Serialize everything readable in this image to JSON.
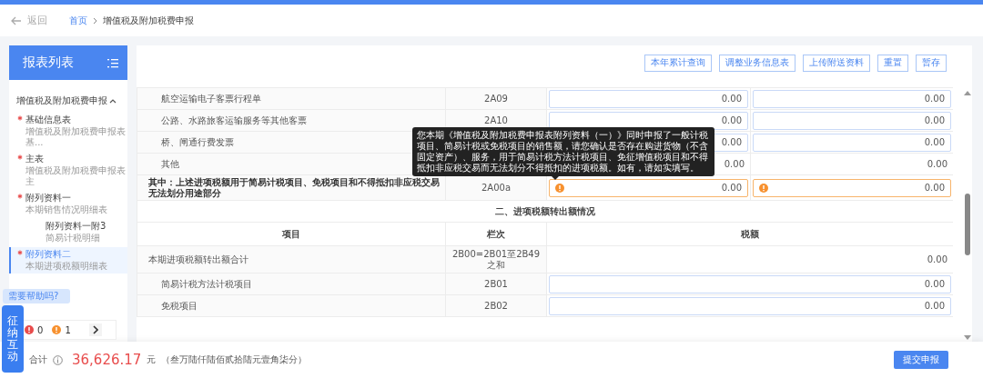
{
  "nav": {
    "back": "返回",
    "breadcrumb": [
      {
        "label": "首页",
        "kind": "link"
      },
      {
        "label": "增值税及附加税费申报",
        "kind": "current"
      }
    ]
  },
  "sidebar": {
    "title": "报表列表",
    "groups": [
      {
        "label": "增值税及附加税费申报",
        "expanded": true,
        "children": [
          {
            "label": "基础信息表",
            "subtitle": "增值税及附加税费申报表基...",
            "required": true,
            "selected": false
          },
          {
            "label": "主表",
            "subtitle": "增值税及附加税费申报表主",
            "required": true,
            "selected": false
          },
          {
            "label": "附列资料一",
            "subtitle": "本期销售情况明细表",
            "required": true,
            "selected": false,
            "children": [
              {
                "label": "附列资料一附3",
                "subtitle": "简易计税明细",
                "required": false,
                "selected": false
              }
            ]
          },
          {
            "label": "附列资料二",
            "subtitle": "本期进项税额明细表",
            "required": true,
            "selected": true
          }
        ]
      }
    ]
  },
  "toolbar": [
    "本年累计查询",
    "调整业务信息表",
    "上传附送资料",
    "重置",
    "暂存"
  ],
  "table": {
    "rows": [
      {
        "label": "航空运输电子客票行程单",
        "code": "2A09",
        "indented": true,
        "bold": false,
        "cells": [
          {
            "kind": "input",
            "value": "0.00"
          },
          {
            "kind": "input",
            "value": "0.00"
          }
        ]
      },
      {
        "label": "公路、水路旅客运输服务等其他客票",
        "code": "2A10",
        "indented": true,
        "bold": false,
        "cells": [
          {
            "kind": "input",
            "value": "0.00"
          },
          {
            "kind": "input",
            "value": "0.00"
          }
        ]
      },
      {
        "label": "桥、闸通行费发票",
        "indented": true,
        "bold": false,
        "cells": [
          {
            "kind": "input",
            "value": "0.00"
          },
          {
            "kind": "input",
            "value": "0.00"
          }
        ]
      },
      {
        "label": "其他",
        "indented": true,
        "bold": false,
        "cells": [
          {
            "kind": "text",
            "value": "0.00"
          },
          {
            "kind": "text",
            "value": "0.00"
          }
        ]
      },
      {
        "label": "其中：上述进项税额用于简易计税项目、免税项目和不得抵扣非应税交易无法划分用途部分",
        "code": "2A00a",
        "indented": false,
        "bold": true,
        "cells": [
          {
            "kind": "warning",
            "value": "0.00"
          },
          {
            "kind": "warning",
            "value": "0.00"
          }
        ]
      }
    ]
  },
  "transfer_section": {
    "title": "二、进项税额转出额情况",
    "columns": [
      "项目",
      "栏次",
      "税额"
    ],
    "rows": [
      {
        "label": "本期进项税额转出额合计",
        "code": "2B00=2B01至2B49之和",
        "indented": false,
        "cell": {
          "kind": "text",
          "value": "0.00"
        }
      },
      {
        "label": "简易计税方法计税项目",
        "code": "2B01",
        "indented": true,
        "cell": {
          "kind": "input",
          "value": "0.00"
        }
      },
      {
        "label": "免税项目",
        "code": "2B02",
        "indented": true,
        "cell": {
          "kind": "input",
          "value": "0.00"
        }
      }
    ]
  },
  "tooltip": "您本期《增值税及附加税费申报表附列资料（一）》同时申报了一般计税项目、简易计税或免税项目的销售额，请您确认是否存在购进货物（不含固定资产）、服务，用于简易计税方法计税项目、免征增值税项目和不得抵扣非应税交易而无法划分不得抵扣的进项税额。如有，请如实填写。",
  "help_bubble": "需要帮助吗?",
  "interaction_tab": "征纳互动",
  "issue_counts": [
    {
      "kind": "error",
      "count": "0"
    },
    {
      "kind": "warning",
      "count": "1"
    }
  ],
  "footer": {
    "label": "合计",
    "amount": "36,626.17",
    "unit": "元",
    "amount_in_words": "（叁万陆仟陆佰贰拾陆元壹角柒分）",
    "submit": "提交申报"
  }
}
